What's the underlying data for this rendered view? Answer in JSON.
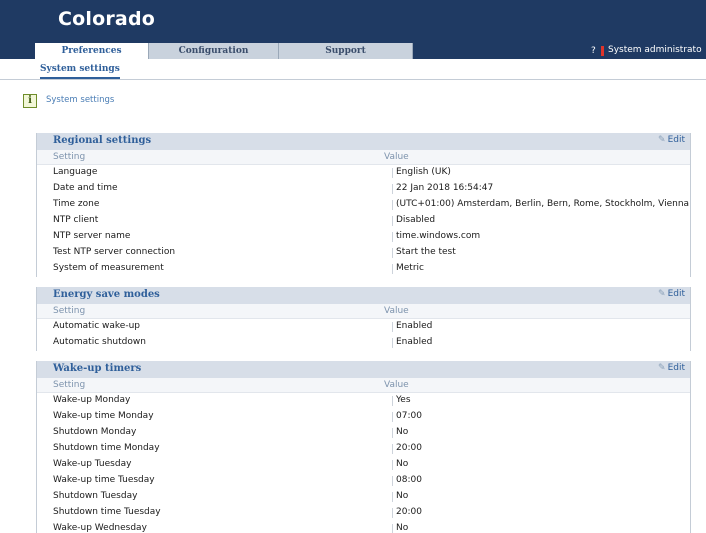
{
  "app": {
    "title": "Colorado"
  },
  "tabs": [
    {
      "label": "Preferences",
      "active": true
    },
    {
      "label": "Configuration",
      "active": false
    },
    {
      "label": "Support",
      "active": false
    }
  ],
  "header_right": {
    "help": "?",
    "user": "System administrato"
  },
  "subtab": {
    "label": "System settings"
  },
  "breadcrumb": {
    "label": "System settings",
    "icon": "info-icon"
  },
  "sections": [
    {
      "title": "Regional settings",
      "edit_label": "Edit",
      "col_setting": "Setting",
      "col_value": "Value",
      "rows": [
        {
          "k": "Language",
          "v": "English (UK)"
        },
        {
          "k": "Date and time",
          "v": "22 Jan 2018 16:54:47"
        },
        {
          "k": "Time zone",
          "v": "(UTC+01:00) Amsterdam, Berlin, Bern, Rome, Stockholm, Vienna"
        },
        {
          "k": "NTP client",
          "v": "Disabled"
        },
        {
          "k": "NTP server name",
          "v": "time.windows.com"
        },
        {
          "k": "Test NTP server connection",
          "v": "Start the test"
        },
        {
          "k": "System of measurement",
          "v": "Metric"
        }
      ]
    },
    {
      "title": "Energy save modes",
      "edit_label": "Edit",
      "col_setting": "Setting",
      "col_value": "Value",
      "rows": [
        {
          "k": "Automatic wake-up",
          "v": "Enabled"
        },
        {
          "k": "Automatic shutdown",
          "v": "Enabled"
        }
      ]
    },
    {
      "title": "Wake-up timers",
      "edit_label": "Edit",
      "col_setting": "Setting",
      "col_value": "Value",
      "rows": [
        {
          "k": "Wake-up Monday",
          "v": "Yes"
        },
        {
          "k": "Wake-up time Monday",
          "v": "07:00"
        },
        {
          "k": "Shutdown Monday",
          "v": "No"
        },
        {
          "k": "Shutdown time Monday",
          "v": "20:00"
        },
        {
          "k": "Wake-up Tuesday",
          "v": "No"
        },
        {
          "k": "Wake-up time Tuesday",
          "v": "08:00"
        },
        {
          "k": "Shutdown Tuesday",
          "v": "No"
        },
        {
          "k": "Shutdown time Tuesday",
          "v": "20:00"
        },
        {
          "k": "Wake-up Wednesday",
          "v": "No"
        }
      ]
    }
  ],
  "colors": {
    "header_bg": "#1f3a63",
    "accent": "#2f5f9a",
    "section_bg": "#d7dee8",
    "user_marker": "#e0342a"
  }
}
